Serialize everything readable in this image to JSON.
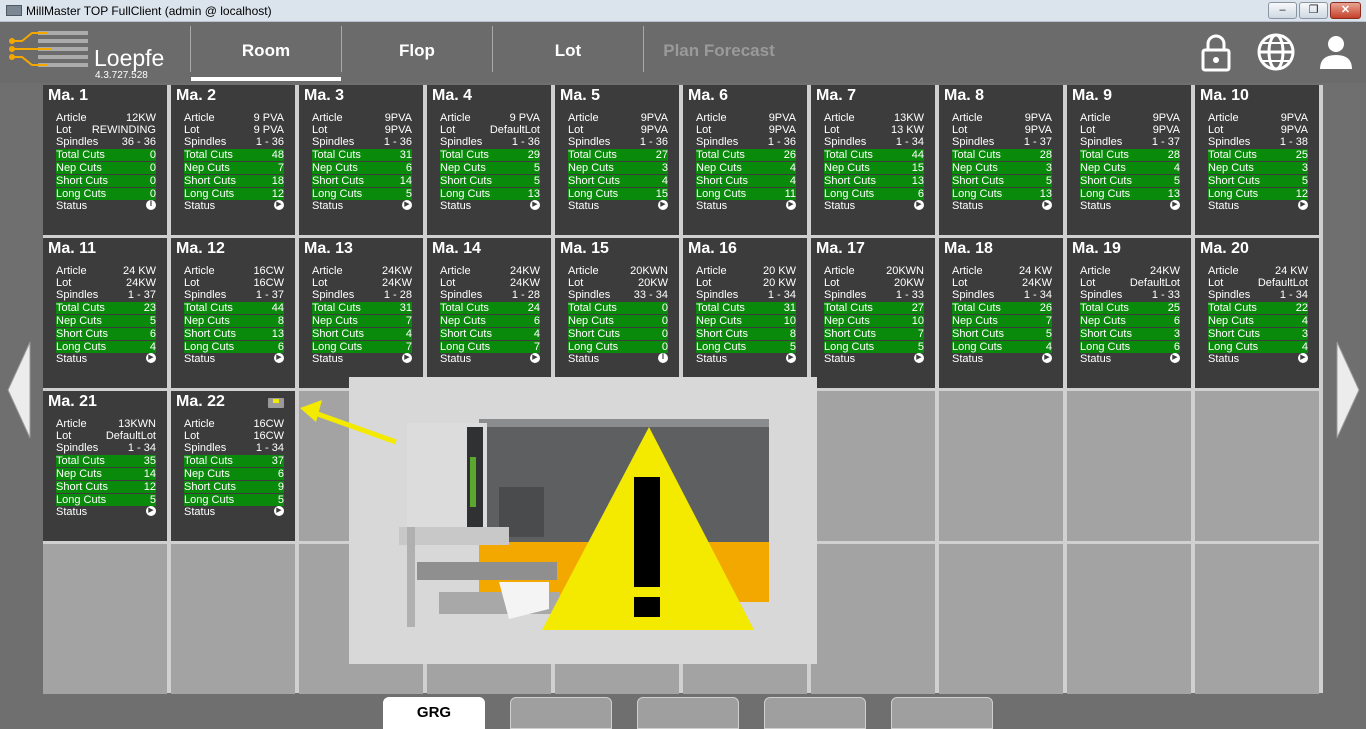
{
  "window": {
    "title": "MillMaster TOP FullClient (admin @ localhost)",
    "min_label": "–",
    "max_label": "❐",
    "close_label": "✕"
  },
  "logo": {
    "brand": "Loepfe",
    "version": "4.3.727.528"
  },
  "nav": {
    "tabs": [
      "Room",
      "Flop",
      "Lot",
      "Plan Forecast"
    ],
    "active": "Room",
    "disabled": [
      "Plan Forecast"
    ],
    "icons": [
      "lock-icon",
      "globe-icon",
      "user-icon"
    ]
  },
  "field_labels": {
    "article": "Article",
    "lot": "Lot",
    "spindles": "Spindles",
    "total_cuts": "Total Cuts",
    "nep_cuts": "Nep Cuts",
    "short_cuts": "Short Cuts",
    "long_cuts": "Long Cuts",
    "status": "Status"
  },
  "machines": [
    {
      "name": "Ma. 1",
      "article": "12KW",
      "lot": "REWINDING",
      "spindles": "36 - 36",
      "total": "0",
      "nep": "0",
      "short": "0",
      "long": "0",
      "status": "paused"
    },
    {
      "name": "Ma. 2",
      "article": "9 PVA",
      "lot": "9 PVA",
      "spindles": "1 - 36",
      "total": "48",
      "nep": "7",
      "short": "18",
      "long": "12",
      "status": "running"
    },
    {
      "name": "Ma. 3",
      "article": "9PVA",
      "lot": "9PVA",
      "spindles": "1 - 36",
      "total": "31",
      "nep": "6",
      "short": "14",
      "long": "5",
      "status": "running"
    },
    {
      "name": "Ma. 4",
      "article": "9 PVA",
      "lot": "DefaultLot",
      "spindles": "1 - 36",
      "total": "29",
      "nep": "5",
      "short": "5",
      "long": "13",
      "status": "running"
    },
    {
      "name": "Ma. 5",
      "article": "9PVA",
      "lot": "9PVA",
      "spindles": "1 - 36",
      "total": "27",
      "nep": "3",
      "short": "4",
      "long": "15",
      "status": "running"
    },
    {
      "name": "Ma. 6",
      "article": "9PVA",
      "lot": "9PVA",
      "spindles": "1 - 36",
      "total": "26",
      "nep": "4",
      "short": "4",
      "long": "11",
      "status": "running"
    },
    {
      "name": "Ma. 7",
      "article": "13KW",
      "lot": "13 KW",
      "spindles": "1 - 34",
      "total": "44",
      "nep": "15",
      "short": "13",
      "long": "6",
      "status": "running"
    },
    {
      "name": "Ma. 8",
      "article": "9PVA",
      "lot": "9PVA",
      "spindles": "1 - 37",
      "total": "28",
      "nep": "3",
      "short": "5",
      "long": "13",
      "status": "running"
    },
    {
      "name": "Ma. 9",
      "article": "9PVA",
      "lot": "9PVA",
      "spindles": "1 - 37",
      "total": "28",
      "nep": "4",
      "short": "5",
      "long": "13",
      "status": "running"
    },
    {
      "name": "Ma. 10",
      "article": "9PVA",
      "lot": "9PVA",
      "spindles": "1 - 38",
      "total": "25",
      "nep": "3",
      "short": "5",
      "long": "12",
      "status": "running"
    },
    {
      "name": "Ma. 11",
      "article": "24 KW",
      "lot": "24KW",
      "spindles": "1 - 37",
      "total": "23",
      "nep": "5",
      "short": "6",
      "long": "4",
      "status": "running"
    },
    {
      "name": "Ma. 12",
      "article": "16CW",
      "lot": "16CW",
      "spindles": "1 - 37",
      "total": "44",
      "nep": "8",
      "short": "13",
      "long": "6",
      "status": "running"
    },
    {
      "name": "Ma. 13",
      "article": "24KW",
      "lot": "24KW",
      "spindles": "1 - 28",
      "total": "31",
      "nep": "7",
      "short": "4",
      "long": "7",
      "status": "running"
    },
    {
      "name": "Ma. 14",
      "article": "24KW",
      "lot": "24KW",
      "spindles": "1 - 28",
      "total": "24",
      "nep": "6",
      "short": "4",
      "long": "7",
      "status": "running"
    },
    {
      "name": "Ma. 15",
      "article": "20KWN",
      "lot": "20KW",
      "spindles": "33 - 34",
      "total": "0",
      "nep": "0",
      "short": "0",
      "long": "0",
      "status": "paused"
    },
    {
      "name": "Ma. 16",
      "article": "20 KW",
      "lot": "20 KW",
      "spindles": "1 - 34",
      "total": "31",
      "nep": "10",
      "short": "8",
      "long": "5",
      "status": "running"
    },
    {
      "name": "Ma. 17",
      "article": "20KWN",
      "lot": "20KW",
      "spindles": "1 - 33",
      "total": "27",
      "nep": "10",
      "short": "7",
      "long": "5",
      "status": "running"
    },
    {
      "name": "Ma. 18",
      "article": "24 KW",
      "lot": "24KW",
      "spindles": "1 - 34",
      "total": "26",
      "nep": "7",
      "short": "5",
      "long": "4",
      "status": "running"
    },
    {
      "name": "Ma. 19",
      "article": "24KW",
      "lot": "DefaultLot",
      "spindles": "1 - 33",
      "total": "25",
      "nep": "6",
      "short": "3",
      "long": "6",
      "status": "running"
    },
    {
      "name": "Ma. 20",
      "article": "24 KW",
      "lot": "DefaultLot",
      "spindles": "1 - 34",
      "total": "22",
      "nep": "4",
      "short": "3",
      "long": "4",
      "status": "running"
    },
    {
      "name": "Ma. 21",
      "article": "13KWN",
      "lot": "DefaultLot",
      "spindles": "1 - 34",
      "total": "35",
      "nep": "14",
      "short": "12",
      "long": "5",
      "status": "running"
    },
    {
      "name": "Ma. 22",
      "article": "16CW",
      "lot": "16CW",
      "spindles": "1 - 34",
      "total": "37",
      "nep": "6",
      "short": "9",
      "long": "5",
      "status": "running",
      "alert_icon": "balance-alert-icon"
    }
  ],
  "colors": {
    "background": "#6f6f6f",
    "card": "#3c3c3c",
    "highlight_rows": "#0a8a0a",
    "warning": "#f4ea00",
    "accent": "#f3a800"
  },
  "bottom_tabs": {
    "labels": [
      "GRG",
      "",
      "",
      "",
      ""
    ],
    "active": "GRG"
  },
  "overlay": {
    "image": "yarn-clearer-sensor-with-warning-sign",
    "icon": "warning-triangle-icon"
  }
}
